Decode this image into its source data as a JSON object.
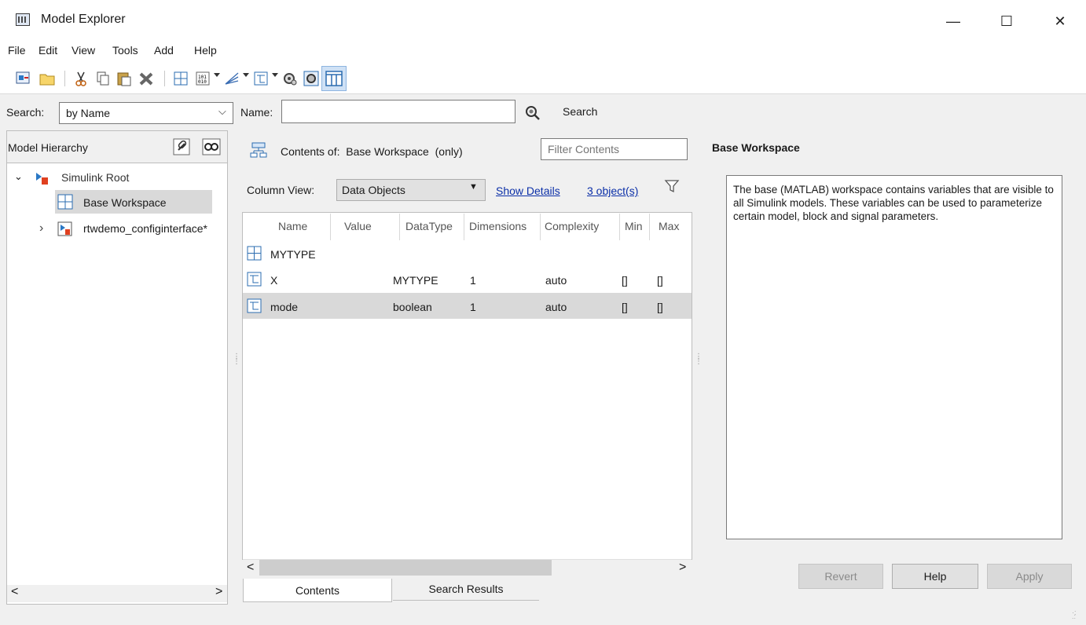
{
  "window": {
    "title": "Model Explorer",
    "minimize_glyph": "—",
    "maximize_glyph": "☐",
    "close_glyph": "✕"
  },
  "menu": [
    "File",
    "Edit",
    "View",
    "Tools",
    "Add",
    "Help"
  ],
  "toolbar": {
    "icons": [
      "new-model-icon",
      "open-icon",
      "cut-icon",
      "copy-icon",
      "paste-icon",
      "delete-icon",
      "add-workspace-icon",
      "add-data-icon",
      "add-bus-icon",
      "add-signal-icon",
      "configuration-icon",
      "properties-icon",
      "dialog-view-icon"
    ]
  },
  "search": {
    "label": "Search:",
    "mode_value": "by Name",
    "name_label": "Name:",
    "name_value": "",
    "search_button": "Search"
  },
  "hierarchy": {
    "title": "Model Hierarchy",
    "items": [
      {
        "label": "Simulink Root",
        "expander": "⌄",
        "icon": "simulink-root-icon"
      },
      {
        "label": "Base Workspace",
        "icon": "workspace-icon",
        "selected": true
      },
      {
        "label": "rtwdemo_configinterface*",
        "expander": "›",
        "icon": "model-icon"
      }
    ],
    "scroll_left": "<",
    "scroll_right": ">"
  },
  "contents": {
    "header": "Contents of:  Base Workspace  (only)",
    "filter_placeholder": "Filter Contents",
    "column_view_label": "Column View:",
    "column_view_value": "Data Objects",
    "show_details": "Show Details",
    "object_count": "3 object(s)",
    "columns": [
      "Name",
      "Value",
      "DataType",
      "Dimensions",
      "Complexity",
      "Min",
      "Max"
    ],
    "rows": [
      {
        "name": "MYTYPE",
        "value": "",
        "datatype": "",
        "dimensions": "",
        "complexity": "",
        "min": "",
        "max": "",
        "icon": "bus-type-icon"
      },
      {
        "name": "X",
        "value": "",
        "datatype": "MYTYPE",
        "dimensions": "1",
        "complexity": "auto",
        "min": "[]",
        "max": "[]",
        "icon": "signal-object-icon"
      },
      {
        "name": "mode",
        "value": "",
        "datatype": "boolean",
        "dimensions": "1",
        "complexity": "auto",
        "min": "[]",
        "max": "[]",
        "icon": "signal-object-icon",
        "selected": true
      }
    ],
    "scroll_left": "<",
    "scroll_right": ">",
    "tabs": [
      "Contents",
      "Search Results"
    ]
  },
  "details": {
    "title": "Base Workspace",
    "description": "The base (MATLAB) workspace contains variables that are visible to all Simulink models. These variables can be used to parameterize certain model, block and signal parameters.",
    "buttons": {
      "revert": "Revert",
      "help": "Help",
      "apply": "Apply"
    }
  }
}
